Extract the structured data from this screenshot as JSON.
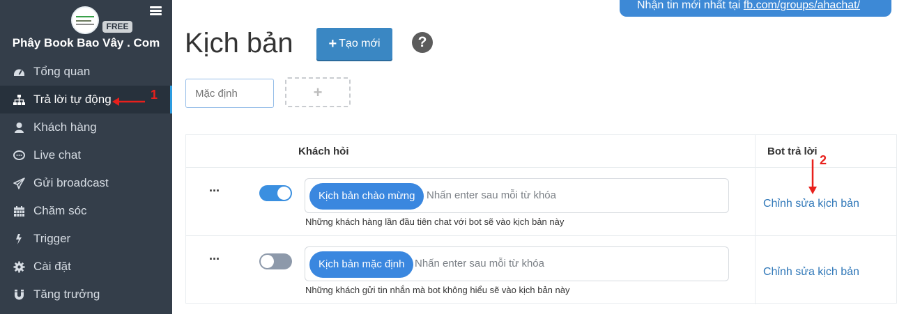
{
  "sidebar": {
    "brand": "Phây Book Bao Vây . Com",
    "badge": "FREE",
    "items": [
      {
        "label": "Tổng quan",
        "icon": "dashboard-icon"
      },
      {
        "label": "Trả lời tự động",
        "icon": "sitemap-icon",
        "active": true
      },
      {
        "label": "Khách hàng",
        "icon": "user-icon"
      },
      {
        "label": "Live chat",
        "icon": "chat-bubble-icon"
      },
      {
        "label": "Gửi broadcast",
        "icon": "paper-plane-icon"
      },
      {
        "label": "Chăm sóc",
        "icon": "calendar-icon"
      },
      {
        "label": "Trigger",
        "icon": "bolt-icon"
      },
      {
        "label": "Cài đặt",
        "icon": "gear-icon"
      },
      {
        "label": "Tăng trưởng",
        "icon": "magnet-icon"
      }
    ]
  },
  "annotations": {
    "first": "1",
    "second": "2"
  },
  "banner": {
    "text": "Nhận tin mới nhất tại ",
    "link": "fb.com/groups/ahachat/"
  },
  "page": {
    "title": "Kịch bản",
    "new_button": "Tạo mới",
    "help": "?",
    "tab_placeholder": "Mặc định",
    "add_tab": "+"
  },
  "table": {
    "headers": {
      "customer": "Khách hỏi",
      "bot": "Bot trả lời"
    },
    "rows": [
      {
        "menu": "···",
        "toggle": "on",
        "chip": "Kịch bản chào mừng",
        "placeholder": "Nhấn enter sau mỗi từ khóa",
        "description": "Những khách hàng lần đầu tiên chat với bot sẽ vào kịch bản này",
        "edit": "Chỉnh sửa kịch bản"
      },
      {
        "menu": "···",
        "toggle": "off",
        "chip": "Kịch bản mặc định",
        "placeholder": "Nhấn enter sau mỗi từ khóa",
        "description": "Những khách gửi tin nhắn mà bot không hiểu sẽ vào kịch bản này",
        "edit": "Chỉnh sửa kịch bản"
      }
    ]
  },
  "colors": {
    "sidebar": "#343e4a",
    "accent": "#3a87df",
    "annotation": "#e8201c"
  }
}
